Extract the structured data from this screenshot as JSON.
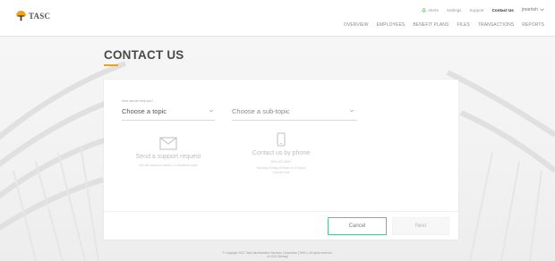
{
  "header": {
    "logo_text": "TASC",
    "utility": {
      "alerts": "Alerts",
      "settings": "Settings",
      "support": "Support",
      "contact": "Contact Us",
      "user": "jmartish"
    },
    "nav": [
      "OVERVIEW",
      "EMPLOYEES",
      "BENEFIT PLANS",
      "FILES",
      "TRANSACTIONS",
      "REPORTS"
    ]
  },
  "page": {
    "title": "CONTACT US"
  },
  "form": {
    "topic_label": "How can we help you?",
    "topic_value": "Choose a topic",
    "subtopic_value": "Choose a sub-topic"
  },
  "options": {
    "support": {
      "title": "Send a support request",
      "description": "We will respond within 1-2 business days"
    },
    "phone": {
      "title": "Contact us by phone",
      "number": "800-422-4661",
      "hours_line1": "Monday-Friday 8:00am to 6:00pm",
      "hours_line2": "Central time"
    }
  },
  "buttons": {
    "cancel": "Cancel",
    "next": "Next"
  },
  "footer": {
    "line1": "© Copyright 2021 Total Administrative Services Corporation (TASC). All rights reserved.",
    "line2": "v1.2021 Sitemap"
  },
  "colors": {
    "accent": "#f0a21b",
    "cancel_border": "#5fbf8e",
    "alerts_icon": "#4caf50"
  }
}
